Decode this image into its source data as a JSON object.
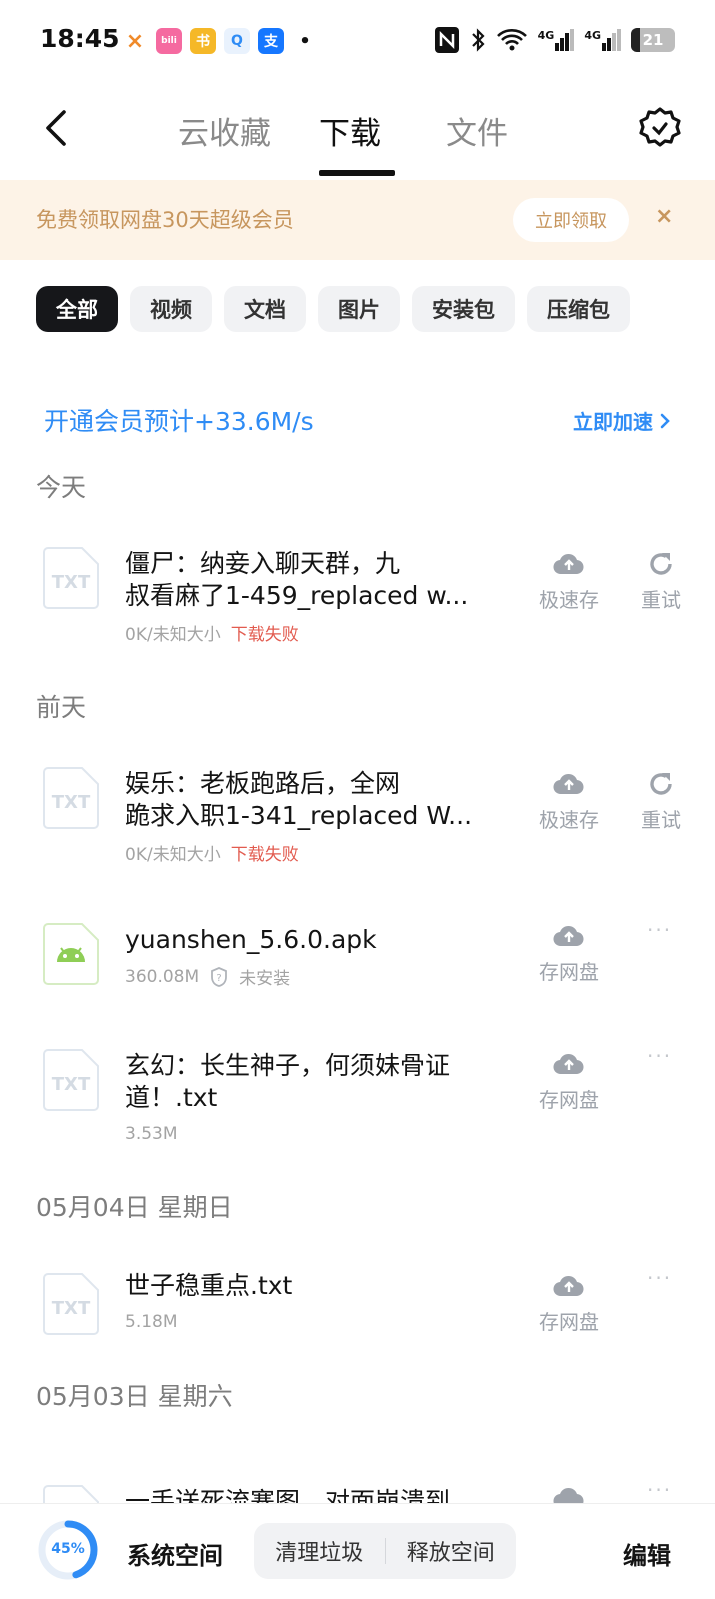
{
  "status": {
    "time": "18:45",
    "apps": [
      "×",
      "bili",
      "书",
      "Q",
      "支",
      "•"
    ],
    "battery": "21",
    "net1": "4G",
    "net2": "4G"
  },
  "nav": {
    "tabs": [
      "云收藏",
      "下载",
      "文件"
    ],
    "active_tab": 1
  },
  "banner": {
    "text": "免费领取网盘30天超级会员",
    "claim_label": "立即领取",
    "close": "×"
  },
  "filters": [
    "全部",
    "视频",
    "文档",
    "图片",
    "安装包",
    "压缩包"
  ],
  "speedup": {
    "text": "开通会员预计+33.6M/s",
    "link": "立即加速"
  },
  "sections": {
    "today": "今天",
    "day_before": "前天",
    "may4": "05月04日 星期日",
    "may3": "05月03日 星期六"
  },
  "files": [
    {
      "icon": "TXT",
      "title_l1": "僵尸：纳妾入聊天群，九",
      "title_l2": "叔看麻了1-459_replaced w...",
      "size": "0K/未知大小",
      "status": "下载失败",
      "action1": "极速存",
      "action2": "重试"
    },
    {
      "icon": "TXT",
      "title_l1": "娱乐：老板跑路后，全网",
      "title_l2": "跪求入职1-341_replaced W...",
      "size": "0K/未知大小",
      "status": "下载失败",
      "action1": "极速存",
      "action2": "重试"
    },
    {
      "icon": "android",
      "title_l1": "yuanshen_5.6.0.apk",
      "size": "360.08M",
      "status": "未安装",
      "action1": "存网盘",
      "action2": "···"
    },
    {
      "icon": "TXT",
      "title_l1": "玄幻：长生神子，何须妹骨证",
      "title_l2": "道！.txt",
      "size": "3.53M",
      "action1": "存网盘",
      "action2": "···"
    },
    {
      "icon": "TXT",
      "title_l1": "世子稳重点.txt",
      "size": "5.18M",
      "action1": "存网盘",
      "action2": "···"
    },
    {
      "icon": "TXT",
      "title_l1": "一手送死流寨图，对面崩溃到",
      "action2": "···"
    }
  ],
  "bottom": {
    "usage_label": "45%",
    "usage_fraction": 0.45,
    "system_space": "系统空间",
    "clean": "清理垃圾",
    "free": "释放空间",
    "edit": "编辑"
  },
  "colors": {
    "accent": "#2f8cf5",
    "banner_bg": "#fdf3e7",
    "banner_text": "#c7965e",
    "fail": "#e25b4f"
  }
}
